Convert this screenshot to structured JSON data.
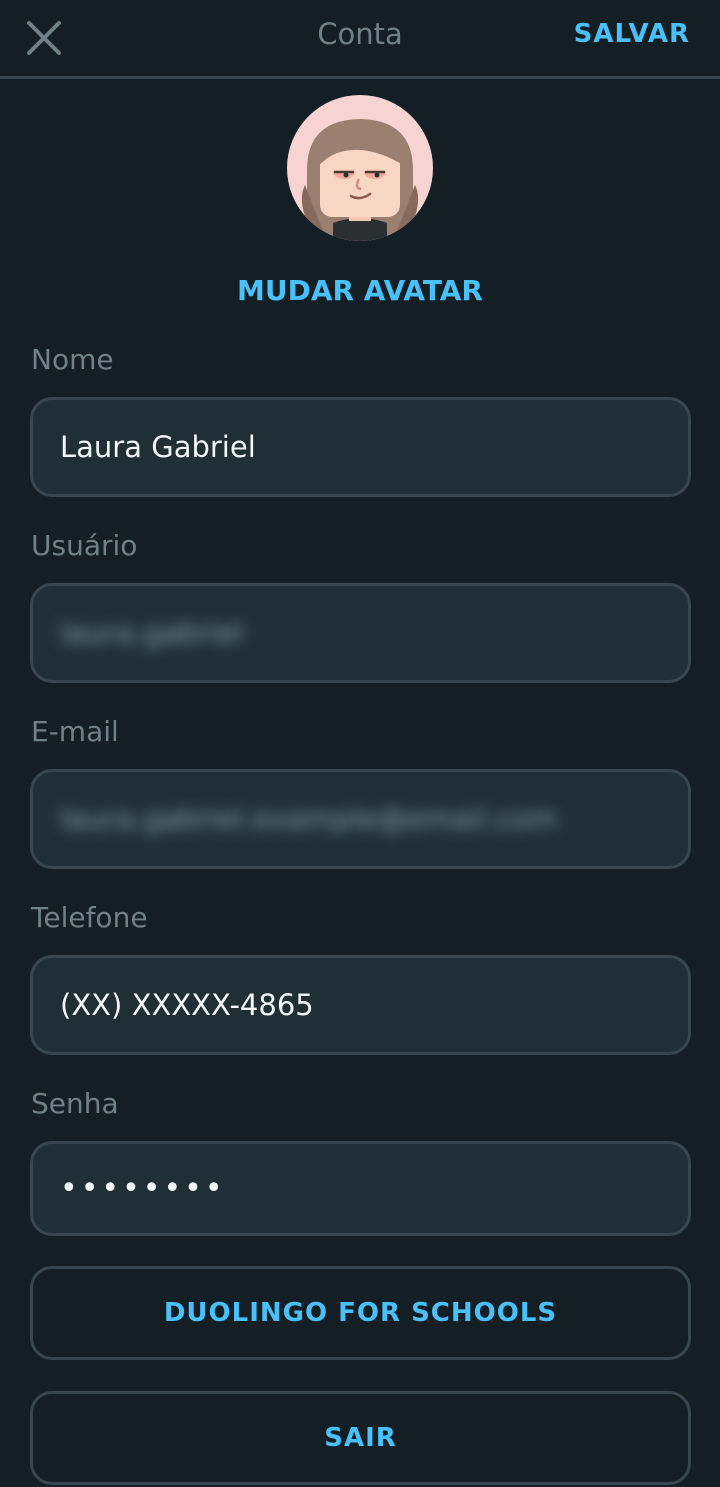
{
  "header": {
    "title": "Conta",
    "save_label": "SALVAR",
    "close_icon": "close-icon"
  },
  "avatar": {
    "change_label": "MUDAR AVATAR"
  },
  "form": {
    "name_label": "Nome",
    "name_value": "Laura Gabriel",
    "username_label": "Usuário",
    "username_value": "laura.gabriel",
    "email_label": "E-mail",
    "email_value": "laura.gabriel.example@email.com",
    "phone_label": "Telefone",
    "phone_value": "(XX) XXXXX-4865",
    "password_label": "Senha",
    "password_value": "••••••••"
  },
  "buttons": {
    "schools_label": "DUOLINGO FOR SCHOOLS",
    "logout_label": "SAIR"
  },
  "colors": {
    "background": "#131f24",
    "accent": "#49c0f8",
    "field_background": "#202f36",
    "border": "#37464f",
    "label": "#6f8088"
  }
}
